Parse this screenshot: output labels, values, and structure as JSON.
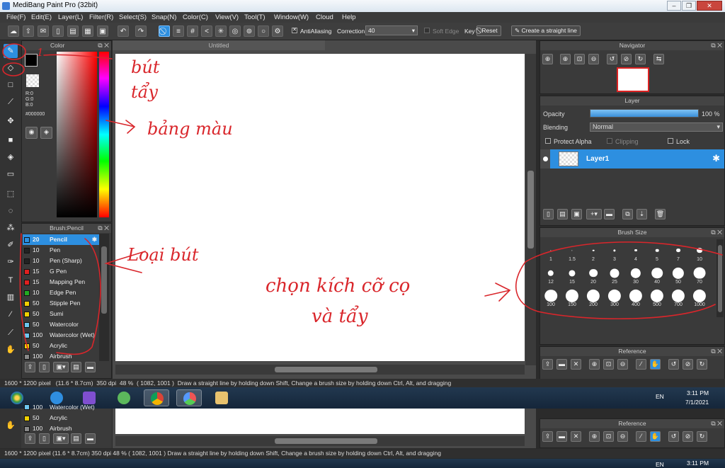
{
  "app": {
    "title": "MediBang Paint Pro (32bit)"
  },
  "menu": [
    "File(F)",
    "Edit(E)",
    "Layer(L)",
    "Filter(R)",
    "Select(S)",
    "Snap(N)",
    "Color(C)",
    "View(V)",
    "Tool(T)",
    "Window(W)",
    "Cloud",
    "Help"
  ],
  "toolbar": {
    "antialiasing_label": "AntiAliasing",
    "correction_label": "Correction",
    "correction_value": "40",
    "soft_edge_label": "Soft Edge",
    "key_label": "Key",
    "reset_label": "Reset",
    "straight_line_label": "Create a straight line"
  },
  "canvas": {
    "tab_title": "Untitled"
  },
  "color_panel": {
    "title": "Color",
    "r": "R:0",
    "g": "G:0",
    "b": "B:0",
    "hex": "#000000",
    "foreground": "#000000"
  },
  "brush_panel": {
    "title": "Brush:Pencil",
    "items": [
      {
        "size": "20",
        "name": "Pencil",
        "color": "#2d8fe0"
      },
      {
        "size": "10",
        "name": "Pen",
        "color": "#222222"
      },
      {
        "size": "10",
        "name": "Pen (Sharp)",
        "color": "#222222"
      },
      {
        "size": "15",
        "name": "G Pen",
        "color": "#e02020"
      },
      {
        "size": "15",
        "name": "Mapping Pen",
        "color": "#e02020"
      },
      {
        "size": "10",
        "name": "Edge Pen",
        "color": "#22aa22"
      },
      {
        "size": "50",
        "name": "Stipple Pen",
        "color": "#f0d000"
      },
      {
        "size": "50",
        "name": "Sumi",
        "color": "#f0d000"
      },
      {
        "size": "50",
        "name": "Watercolor",
        "color": "#6ec6f0"
      },
      {
        "size": "100",
        "name": "Watercolor (Wet)",
        "color": "#6ec6f0"
      },
      {
        "size": "50",
        "name": "Acrylic",
        "color": "#f0d000"
      },
      {
        "size": "100",
        "name": "Airbrush",
        "color": "#888888"
      }
    ]
  },
  "navigator": {
    "title": "Navigator"
  },
  "layer_panel": {
    "title": "Layer",
    "opacity_label": "Opacity",
    "opacity_value": "100 %",
    "opacity_fraction": 1.0,
    "blending_label": "Blending",
    "blending_value": "Normal",
    "protect_alpha_label": "Protect Alpha",
    "clipping_label": "Clipping",
    "lock_label": "Lock",
    "layers": [
      {
        "name": "Layer1"
      }
    ]
  },
  "brush_size": {
    "title": "Brush Size",
    "sizes": [
      "1",
      "1.5",
      "2",
      "3",
      "4",
      "5",
      "7",
      "10",
      "12",
      "15",
      "20",
      "25",
      "30",
      "40",
      "50",
      "70",
      "100",
      "150",
      "200",
      "300",
      "400",
      "500",
      "700",
      "1000"
    ]
  },
  "reference": {
    "title": "Reference"
  },
  "status": {
    "dimensions": "1600 * 1200 pixel",
    "physical": "(11.6 * 8.7cm)",
    "dpi": "350 dpi",
    "zoom": "48 %",
    "coords": "( 1082, 1001 )",
    "hint": "Draw a straight line by holding down Shift, Change a brush size by holding down Ctrl, Alt, and dragging"
  },
  "taskbar": {
    "lang": "EN",
    "time": "3:11 PM",
    "date": "7/1/2021"
  },
  "annotations": {
    "a1": "1",
    "pen": "bút",
    "eraser": "tẩy",
    "palette": "bảng màu",
    "brush_types": "Loại bút",
    "size_line1": "chọn kích cỡ cọ",
    "size_line2": "và tẩy"
  },
  "lower_repeat": {
    "items": [
      {
        "size": "100",
        "name": "Watercolor (Wet)"
      },
      {
        "size": "50",
        "name": "Acrylic"
      },
      {
        "size": "100",
        "name": "Airbrush"
      }
    ],
    "reference_title": "Reference",
    "status": "1600 * 1200 pixel   (11.6 * 8.7cm)  350 dpi  48 %   ( 1082, 1001 )   Draw a straight line by holding down Shift, Change a brush size by holding down Ctrl, Alt, and dragging",
    "lang": "EN",
    "time": "3:11 PM"
  }
}
